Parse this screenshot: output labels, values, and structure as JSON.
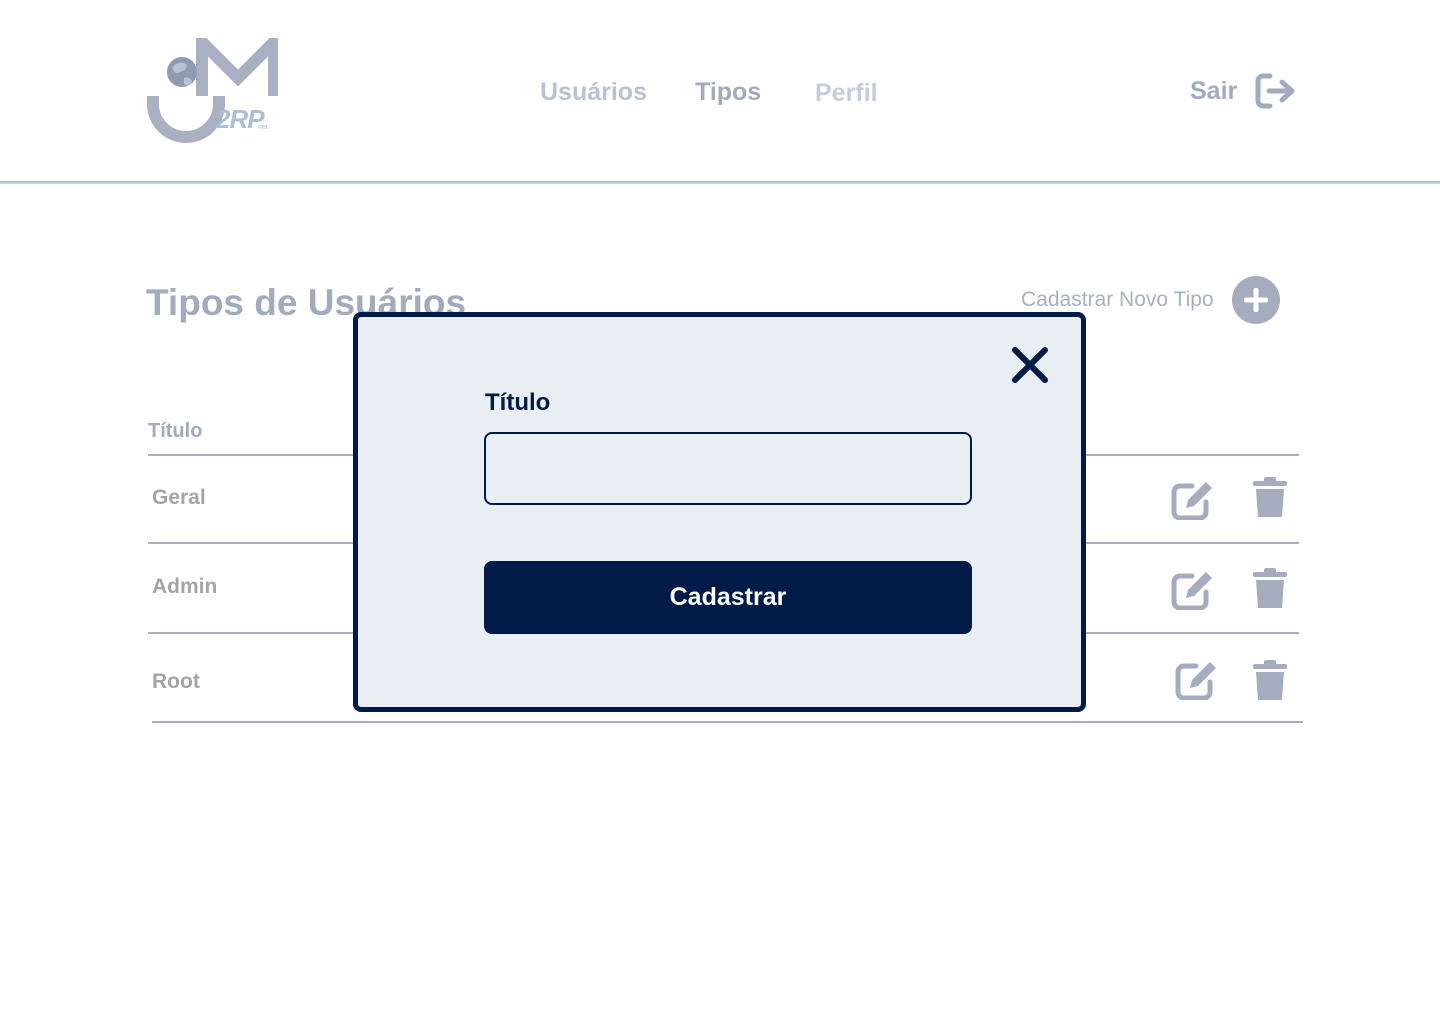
{
  "header": {
    "logo": {
      "text": "2RP",
      "sub": "net",
      "icon": "globe-logo-icon"
    },
    "nav": [
      {
        "label": "Usuários"
      },
      {
        "label": "Tipos"
      },
      {
        "label": "Perfil"
      }
    ],
    "logout": {
      "label": "Sair",
      "icon": "sign-out-icon"
    }
  },
  "page": {
    "title": "Tipos de Usuários",
    "add_label": "Cadastrar Novo Tipo",
    "add_icon": "plus-icon"
  },
  "table": {
    "column_header": "Título",
    "rows": [
      {
        "title": "Geral"
      },
      {
        "title": "Admin"
      },
      {
        "title": "Root"
      }
    ],
    "edit_icon": "edit-icon",
    "delete_icon": "trash-icon"
  },
  "modal": {
    "close_icon": "close-icon",
    "field_label": "Título",
    "field_value": "",
    "field_placeholder": "",
    "submit_label": "Cadastrar"
  },
  "colors": {
    "primary": "#011a48",
    "muted": "#a2aabe",
    "modal_bg": "#e9eef2"
  }
}
